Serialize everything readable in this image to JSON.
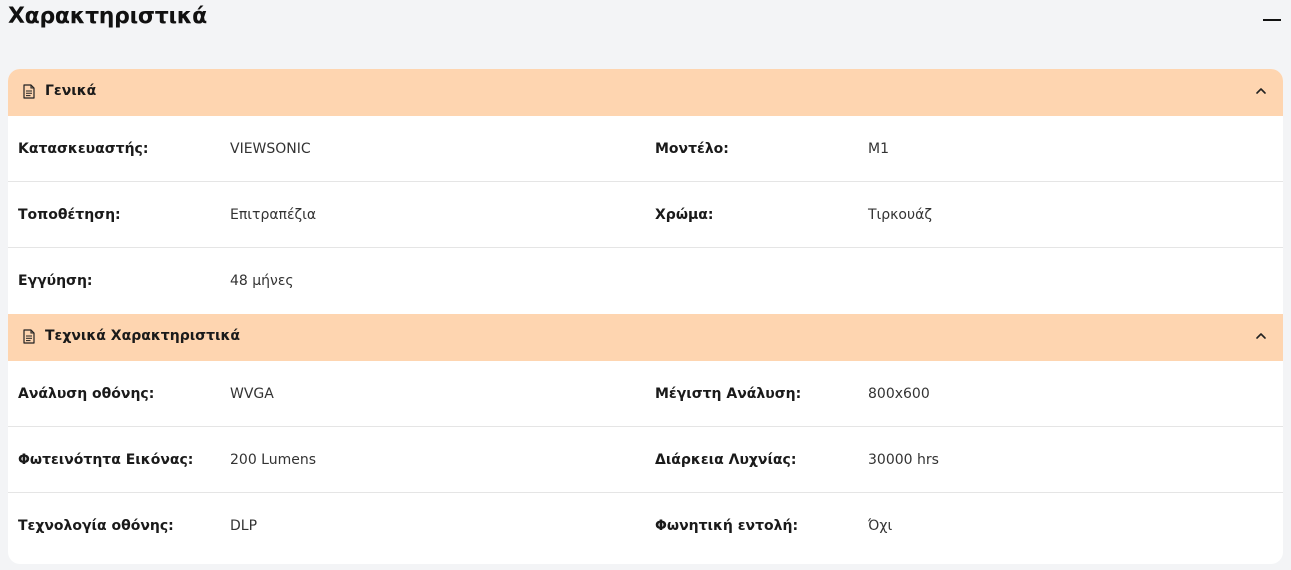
{
  "page_title": "Χαρακτηριστικά",
  "sections": [
    {
      "title": "Γενικά",
      "icon": "document-icon",
      "rows": [
        {
          "label1": "Κατασκευαστής:",
          "value1": "VIEWSONIC",
          "label2": "Μοντέλο:",
          "value2": "M1"
        },
        {
          "label1": "Τοποθέτηση:",
          "value1": "Επιτραπέζια",
          "label2": "Χρώμα:",
          "value2": "Τιρκουάζ"
        },
        {
          "label1": "Εγγύηση:",
          "value1": "48 μήνες",
          "label2": "",
          "value2": ""
        }
      ]
    },
    {
      "title": "Τεχνικά Χαρακτηριστικά",
      "icon": "document-icon",
      "rows": [
        {
          "label1": "Ανάλυση οθόνης:",
          "value1": "WVGA",
          "label2": "Μέγιστη Ανάλυση:",
          "value2": "800x600"
        },
        {
          "label1": "Φωτεινότητα Εικόνας:",
          "value1": "200 Lumens",
          "label2": "Διάρκεια Λυχνίας:",
          "value2": "30000 hrs"
        },
        {
          "label1": "Τεχνολογία οθόνης:",
          "value1": "DLP",
          "label2": "Φωνητική εντολή:",
          "value2": "Όχι"
        }
      ]
    }
  ],
  "colors": {
    "section_header_bg": "#fed5b0",
    "page_bg": "#f3f4f6",
    "card_bg": "#ffffff"
  }
}
